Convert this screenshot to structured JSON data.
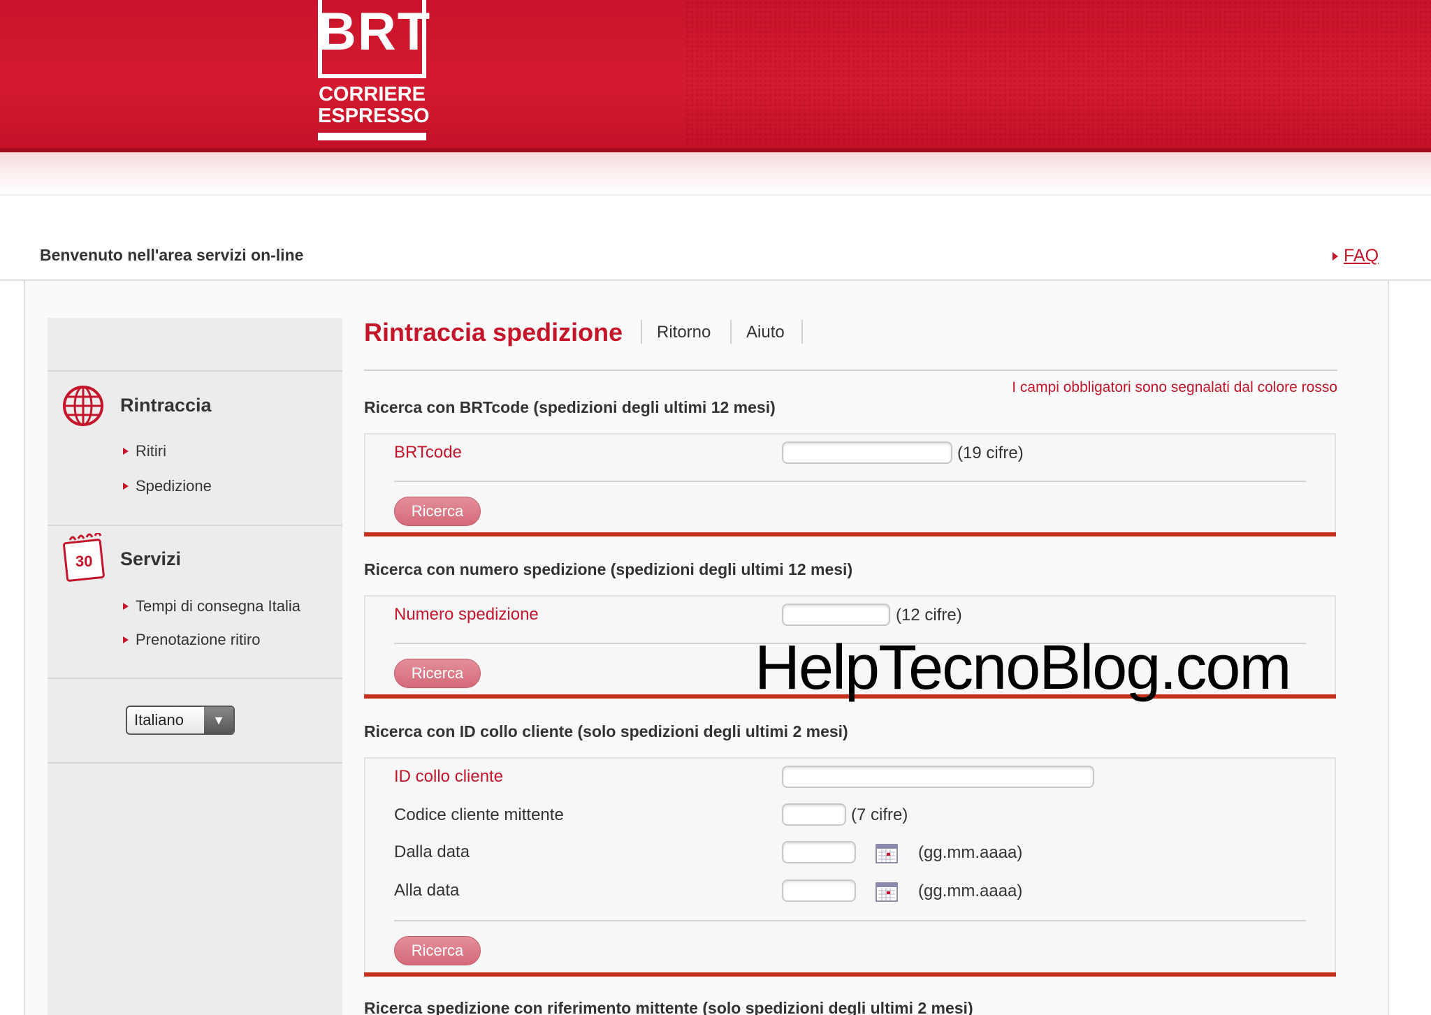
{
  "header": {
    "brand": "BRT",
    "tagline_line1": "CORRIERE",
    "tagline_line2": "ESPRESSO"
  },
  "welcome": {
    "text": "Benvenuto  nell'area servizi on-line",
    "faq_label": "FAQ"
  },
  "sidebar": {
    "sections": [
      {
        "title": "Rintraccia",
        "icon": "globe-icon",
        "items": [
          "Ritiri",
          "Spedizione"
        ]
      },
      {
        "title": "Servizi",
        "icon": "calendar-icon",
        "items": [
          "Tempi di consegna Italia",
          "Prenotazione ritiro"
        ]
      }
    ],
    "language": {
      "selected": "Italiano"
    }
  },
  "main": {
    "title": "Rintraccia spedizione",
    "nav": [
      "Ritorno",
      "Aiuto"
    ],
    "required_note": "I campi obbligatori sono segnalati dal colore rosso",
    "sections": [
      {
        "title": "Ricerca con BRTcode (spedizioni degli ultimi 12 mesi)",
        "fields": [
          {
            "label": "BRTcode",
            "required": true,
            "hint": "(19 cifre)",
            "value": ""
          }
        ],
        "button": "Ricerca"
      },
      {
        "title": "Ricerca con numero spedizione (spedizioni degli ultimi 12 mesi)",
        "fields": [
          {
            "label": "Numero spedizione",
            "required": true,
            "hint": "(12 cifre)",
            "value": ""
          }
        ],
        "button": "Ricerca"
      },
      {
        "title": "Ricerca con ID collo cliente (solo spedizioni degli ultimi 2 mesi)",
        "fields": [
          {
            "label": "ID collo cliente",
            "required": true,
            "hint": "",
            "value": ""
          },
          {
            "label": "Codice cliente mittente",
            "required": false,
            "hint": "(7 cifre)",
            "value": ""
          },
          {
            "label": "Dalla data",
            "required": false,
            "hint": "(gg.mm.aaaa)",
            "value": ""
          },
          {
            "label": "Alla data",
            "required": false,
            "hint": "(gg.mm.aaaa)",
            "value": ""
          }
        ],
        "button": "Ricerca"
      },
      {
        "title": "Ricerca spedizione con riferimento mittente (solo spedizioni degli ultimi 2 mesi)"
      }
    ]
  },
  "watermark": "HelpTecnoBlog.com",
  "colors": {
    "brand_red": "#c4152a",
    "header_red": "#d41a30",
    "section_rule": "#c8301e"
  }
}
